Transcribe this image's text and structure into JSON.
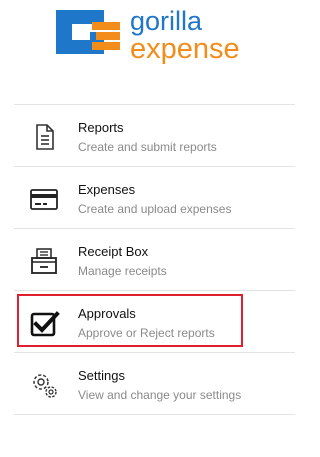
{
  "logo": {
    "word_top": "gorilla",
    "word_bottom": "expense",
    "brand_blue": "#1f77c9",
    "brand_orange": "#f28c1b"
  },
  "menu": {
    "items": [
      {
        "title": "Reports",
        "subtitle": "Create and submit reports",
        "icon": "document-icon",
        "icon_name": "reports-icon"
      },
      {
        "title": "Expenses",
        "subtitle": "Create and upload expenses",
        "icon": "credit-card-icon"
      },
      {
        "title": "Receipt Box",
        "subtitle": "Manage receipts",
        "icon": "receipt-box-icon"
      },
      {
        "title": "Approvals",
        "subtitle": "Approve or Reject reports",
        "icon": "checkbox-icon",
        "highlighted": true
      },
      {
        "title": "Settings",
        "subtitle": "View and change your settings",
        "icon": "gear-icon"
      }
    ]
  },
  "colors": {
    "highlight_border": "#e01e2e",
    "title_text": "#111111",
    "subtitle_text": "#8a8a8a"
  }
}
